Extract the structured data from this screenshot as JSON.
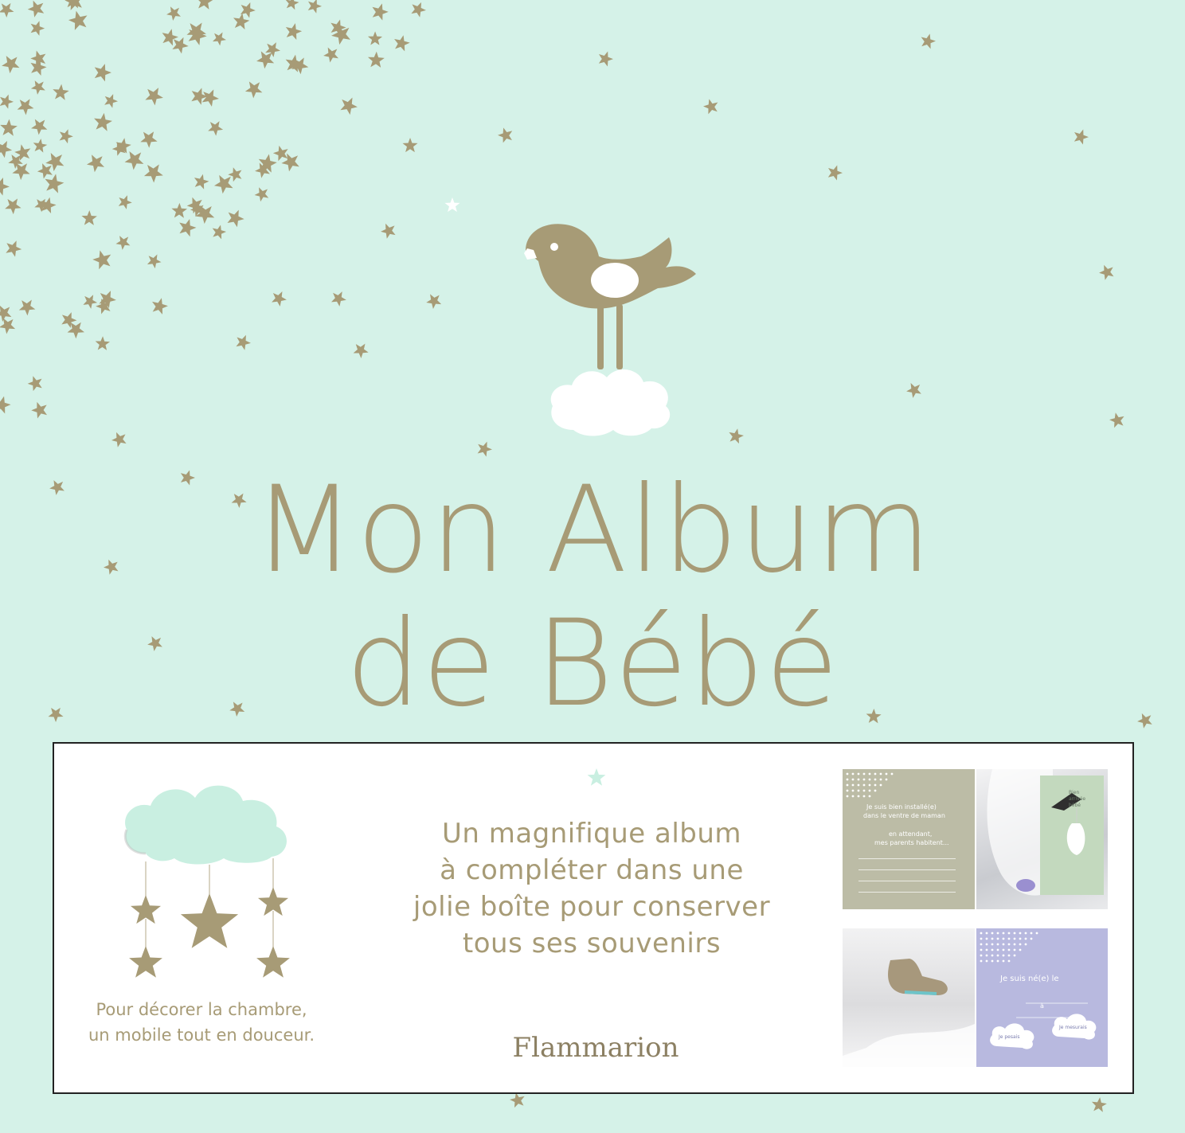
{
  "title": {
    "line1": "Mon Album",
    "line2": "de Bébé"
  },
  "band": {
    "caption": {
      "line1": "Pour décorer la chambre,",
      "line2": "un mobile tout en douceur."
    },
    "tagline": {
      "line1": "Un magnifique album",
      "line2": "à compléter dans une",
      "line3": "jolie boîte pour conserver",
      "line4": "tous ses souvenirs"
    },
    "publisher": "Flammarion",
    "thumbnails": {
      "page1": {
        "line1": "Je suis bien installé(e)",
        "line2": "dans le ventre de maman",
        "line3": "en attendant,",
        "line4": "mes parents habitent..."
      },
      "card": {
        "line1": "Bien",
        "line2": "arrivée",
        "line3": "bébé"
      },
      "page4": {
        "line1": "Je suis né(e) le",
        "line2": "à",
        "cloud1": "Je pesais",
        "cloud2": "Je mesurais"
      }
    }
  },
  "colors": {
    "background": "#d5f2e8",
    "gold": "#a79b76",
    "cloud_mint": "#c9efe1",
    "white": "#ffffff"
  },
  "icons": {
    "bird": "bird-icon",
    "cloud": "cloud-icon",
    "star": "star-icon"
  }
}
